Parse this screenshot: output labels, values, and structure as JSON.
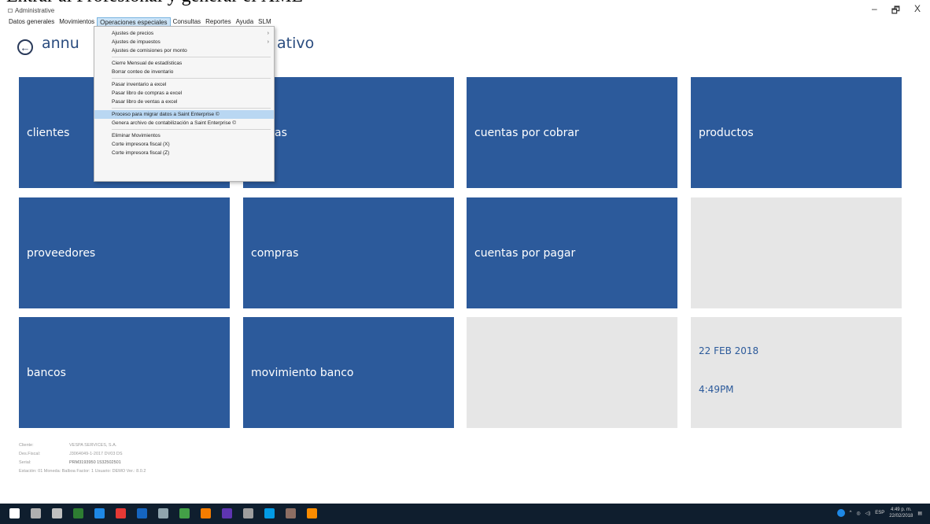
{
  "overlay_caption": "Entrar al Profesional y generar el XML",
  "window": {
    "title": "Administrative",
    "controls": {
      "minimize": "–",
      "maximize": "🗗",
      "close": "X"
    }
  },
  "menubar": {
    "items": [
      "Datos generales",
      "Movimientos",
      "Operaciones especiales",
      "Consultas",
      "Reportes",
      "Ayuda",
      "SLM"
    ],
    "active": "Operaciones especiales"
  },
  "header": {
    "back_icon": "arrow-left-circle-icon",
    "title_left": "annu",
    "title_right": "ativo"
  },
  "dropdown": {
    "groups": [
      [
        "Ajustes de precios",
        "Ajustes de impuestos",
        "Ajustes de comisiones por monto"
      ],
      [
        "Cierre Mensual de estadísticas",
        "Borrar conteo de inventario"
      ],
      [
        "Pasar inventario a excel",
        "Pasar libro de compras a excel",
        "Pasar libro de ventas a excel"
      ],
      [
        "Proceso para migrar datos a Saint Enterprise ©",
        "Genera archivo de contabilización a Saint Enterprise ©"
      ],
      [
        "Eliminar Movimientos",
        "Corte impresora fiscal (X)",
        "Corte impresora fiscal (Z)"
      ]
    ],
    "submenu_arrow": "›",
    "highlighted": "Proceso para migrar datos a Saint Enterprise ©"
  },
  "tiles": {
    "clientes": "clientes",
    "ventas_partial": "as",
    "cuentas_por_cobrar": "cuentas por cobrar",
    "productos": "productos",
    "proveedores": "proveedores",
    "compras": "compras",
    "cuentas_por_pagar": "cuentas por pagar",
    "bancos": "bancos",
    "movimiento_banco": "movimiento banco",
    "date": "22 FEB 2018",
    "time": "4:49PM"
  },
  "footer": [
    {
      "label": "Cliente:",
      "value": "VESPA SERVICES, S.A."
    },
    {
      "label": "Des.Fiscal:",
      "value": "J3064049-1-2017 DV03 DS"
    },
    {
      "label": "Serial:",
      "value": "PRM3193950 1532502501"
    },
    {
      "label": "Estación: 01 Moneda: Balboa Factor: 1 Usuario: DEMO Ver.: 8.0.2",
      "value": ""
    }
  ],
  "taskbar": {
    "language": "ESP",
    "clock_time": "4:49 p. m.",
    "clock_date": "22/02/2018",
    "colors": {
      "bg": "#0f1e2e",
      "icons": [
        "#ffffff",
        "#b0b0b0",
        "#c0c0c0",
        "#2e7d32",
        "#1e88e5",
        "#e53935",
        "#1565c0",
        "#90a4ae",
        "#43a047",
        "#f57c00",
        "#5e35b1",
        "#9e9e9e",
        "#039be5",
        "#8d6e63",
        "#fb8c00"
      ]
    }
  },
  "colors": {
    "tile_blue": "#2c5a9b",
    "tile_empty": "#e6e6e6",
    "title_blue": "#2a4c7f",
    "highlight": "#b9d7f2"
  }
}
